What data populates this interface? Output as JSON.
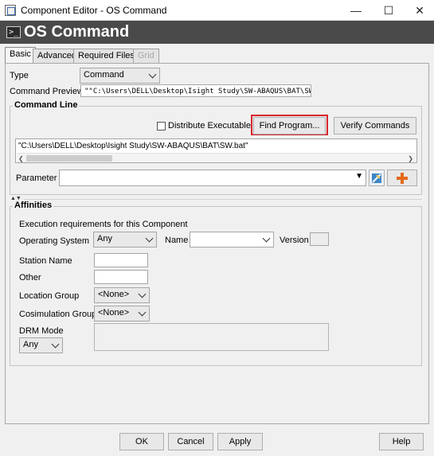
{
  "window": {
    "title": "Component Editor - OS Command",
    "minimize": "—",
    "maximize": "☐",
    "close": "✕"
  },
  "header": {
    "title": "OS Command",
    "icon_glyph": ">_"
  },
  "tabs": [
    {
      "label": "Basic",
      "active": true
    },
    {
      "label": "Advanced"
    },
    {
      "label": "Required Files"
    },
    {
      "label": "Grid",
      "disabled": true
    }
  ],
  "basic": {
    "type_label": "Type",
    "type_value": "Command",
    "preview_label": "Command Preview",
    "preview_value": "\"\"C:\\Users\\DELL\\Desktop\\Isight Study\\SW-ABAQUS\\BAT\\SW.bat\"\""
  },
  "command_line": {
    "group_title": "Command Line",
    "distribute_label": "Distribute Executable",
    "find_program_label": "Find Program...",
    "verify_label": "Verify Commands",
    "command_value": "\"C:\\Users\\DELL\\Desktop\\Isight Study\\SW-ABAQUS\\BAT\\SW.bat\"",
    "parameter_label": "Parameter",
    "parameter_value": ""
  },
  "affinities": {
    "group_title": "Affinities",
    "requirements_text": "Execution requirements for this Component",
    "os_label": "Operating System",
    "os_value": "Any",
    "name_label": "Name",
    "name_value": "",
    "version_label": "Version",
    "station_label": "Station Name",
    "other_label": "Other",
    "location_label": "Location Group",
    "location_value": "<None>",
    "cosim_label": "Cosimulation Group",
    "cosim_value": "<None>",
    "drm_label": "DRM Mode",
    "drm_value": "Any"
  },
  "footer": {
    "ok": "OK",
    "cancel": "Cancel",
    "apply": "Apply",
    "help": "Help"
  },
  "colors": {
    "highlight_border": "#d9252b",
    "banner_bg": "#4a4a4a",
    "add_icon": "#e36a1a"
  }
}
